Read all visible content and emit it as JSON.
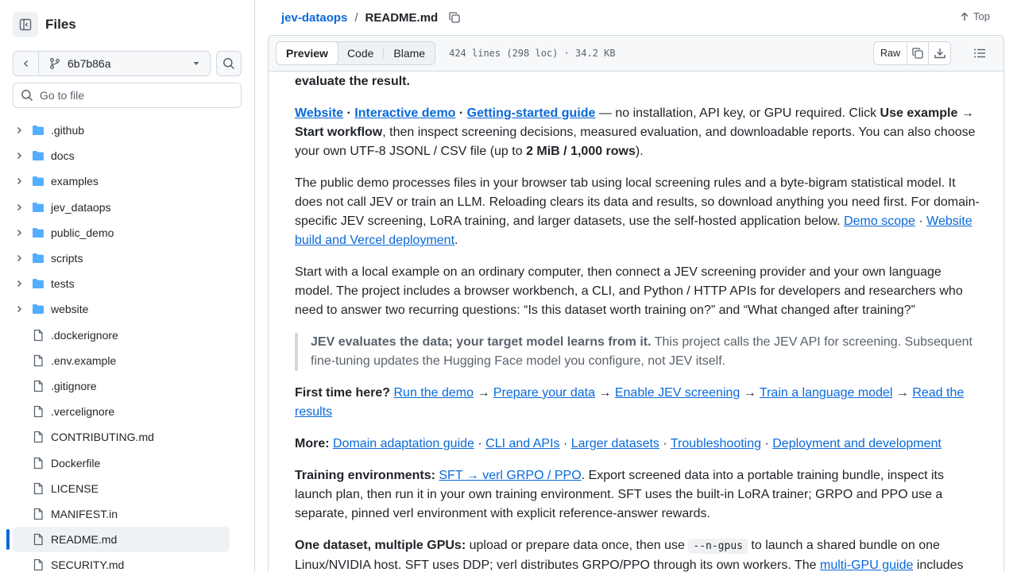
{
  "sidebar": {
    "title": "Files",
    "branch": "6b7b86a",
    "goto_placeholder": "Go to file",
    "items": [
      {
        "type": "folder",
        "label": ".github"
      },
      {
        "type": "folder",
        "label": "docs"
      },
      {
        "type": "folder",
        "label": "examples"
      },
      {
        "type": "folder",
        "label": "jev_dataops"
      },
      {
        "type": "folder",
        "label": "public_demo"
      },
      {
        "type": "folder",
        "label": "scripts"
      },
      {
        "type": "folder",
        "label": "tests"
      },
      {
        "type": "folder",
        "label": "website"
      },
      {
        "type": "file",
        "label": ".dockerignore"
      },
      {
        "type": "file",
        "label": ".env.example"
      },
      {
        "type": "file",
        "label": ".gitignore"
      },
      {
        "type": "file",
        "label": ".vercelignore"
      },
      {
        "type": "file",
        "label": "CONTRIBUTING.md"
      },
      {
        "type": "file",
        "label": "Dockerfile"
      },
      {
        "type": "file",
        "label": "LICENSE"
      },
      {
        "type": "file",
        "label": "MANIFEST.in"
      },
      {
        "type": "file",
        "label": "README.md",
        "active": true
      },
      {
        "type": "file",
        "label": "SECURITY.md"
      }
    ]
  },
  "header": {
    "repo": "jev-dataops",
    "sep": "/",
    "file": "README.md",
    "top_label": "Top"
  },
  "toolbar": {
    "tabs": [
      "Preview",
      "Code",
      "Blame"
    ],
    "meta": "424 lines (298 loc) · 34.2 KB",
    "raw_label": "Raw"
  },
  "colors": {
    "accent": "#0969da",
    "folder": "#54aeff",
    "muted": "#59636e"
  },
  "readme": {
    "p0": "evaluate the result.",
    "p1": {
      "link_website": "Website",
      "dot1": " · ",
      "link_demo": "Interactive demo",
      "dot2": " · ",
      "link_guide": "Getting-started guide",
      "t1": " — no installation, API key, or GPU required. Click ",
      "b1": "Use example → Start workflow",
      "t2": ", then inspect screening decisions, measured evaluation, and downloadable reports. You can also choose your own UTF-8 JSONL / CSV file (up to ",
      "b2": "2 MiB / 1,000 rows",
      "t3": ")."
    },
    "p2": {
      "t1": "The public demo processes files in your browser tab using local screening rules and a byte-bigram statistical model. It does not call JEV or train an LLM. Reloading clears its data and results, so download anything you need first. For domain-specific JEV screening, LoRA training, and larger datasets, use the self-hosted application below. ",
      "link_scope": "Demo scope",
      "dot": " · ",
      "link_build": "Website build and Vercel deployment",
      "t2": "."
    },
    "p3": "Start with a local example on an ordinary computer, then connect a JEV screening provider and your own language model. The project includes a browser workbench, a CLI, and Python / HTTP APIs for developers and researchers who need to answer two recurring questions: “Is this dataset worth training on?” and “What changed after training?”",
    "quote": {
      "b": "JEV evaluates the data; your target model learns from it.",
      "t": " This project calls the JEV API for screening. Subsequent fine-tuning updates the Hugging Face model you configure, not JEV itself."
    },
    "first": {
      "b": "First time here?",
      "l1": "Run the demo",
      "l2": "Prepare your data",
      "l3": "Enable JEV screening",
      "l4": "Train a language model",
      "l5": "Read the results",
      "arrow": " → "
    },
    "more": {
      "b": "More:",
      "l1": "Domain adaptation guide",
      "l2": "CLI and APIs",
      "l3": "Larger datasets",
      "l4": "Troubleshooting",
      "l5": "Deployment and development",
      "dot": " · "
    },
    "train": {
      "b": "Training environments:",
      "l1": "SFT → verl GRPO / PPO",
      "t": ". Export screened data into a portable training bundle, inspect its launch plan, then run it in your own training environment. SFT uses the built-in LoRA trainer; GRPO and PPO use a separate, pinned verl environment with explicit reference-answer rewards."
    },
    "gpu": {
      "b": "One dataset, multiple GPUs:",
      "t1": " upload or prepare data once, then use ",
      "code": "--n-gpus",
      "t2": " to launch a shared bundle on one Linux/NVIDIA host. SFT uses DDP; verl distributes GRPO/PPO through its own workers. The ",
      "l1": "multi-GPU guide",
      "t3": " includes"
    }
  }
}
